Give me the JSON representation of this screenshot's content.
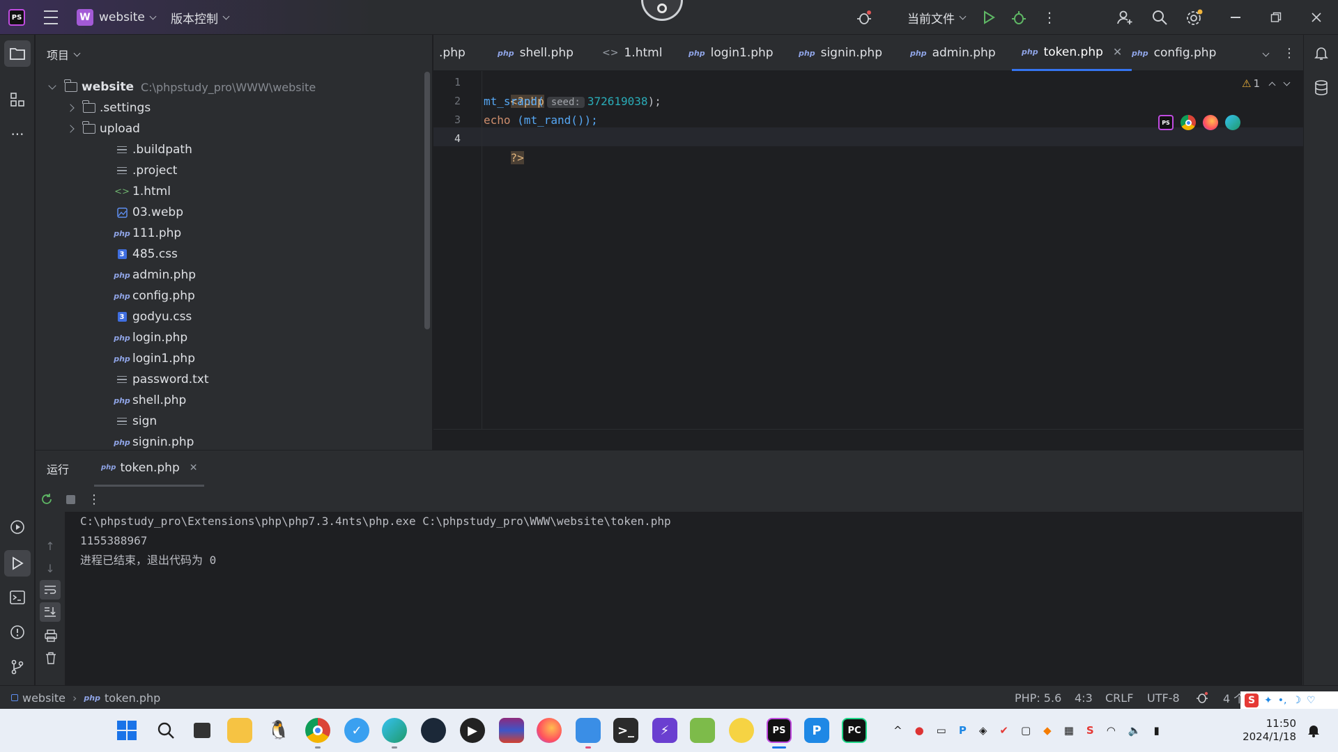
{
  "titlebar": {
    "project_name": "website",
    "project_badge": "W",
    "vcs_menu": "版本控制",
    "run_config": "当前文件"
  },
  "project_panel": {
    "header": "项目",
    "root": {
      "name": "website",
      "path": "C:\\phpstudy_pro\\WWW\\website"
    },
    "items": [
      {
        "name": ".settings",
        "type": "folder"
      },
      {
        "name": "upload",
        "type": "folder"
      },
      {
        "name": ".buildpath",
        "type": "text"
      },
      {
        "name": ".project",
        "type": "text"
      },
      {
        "name": "1.html",
        "type": "html"
      },
      {
        "name": "03.webp",
        "type": "image"
      },
      {
        "name": "111.php",
        "type": "php"
      },
      {
        "name": "485.css",
        "type": "css"
      },
      {
        "name": "admin.php",
        "type": "php"
      },
      {
        "name": "config.php",
        "type": "php"
      },
      {
        "name": "godyu.css",
        "type": "css"
      },
      {
        "name": "login.php",
        "type": "php"
      },
      {
        "name": "login1.php",
        "type": "php"
      },
      {
        "name": "password.txt",
        "type": "text"
      },
      {
        "name": "shell.php",
        "type": "php"
      },
      {
        "name": "sign",
        "type": "text"
      },
      {
        "name": "signin.php",
        "type": "php"
      }
    ]
  },
  "editor": {
    "tabs": [
      {
        "label": ".php",
        "type": "partial"
      },
      {
        "label": "shell.php",
        "type": "php"
      },
      {
        "label": "1.html",
        "type": "html"
      },
      {
        "label": "login1.php",
        "type": "php"
      },
      {
        "label": "signin.php",
        "type": "php"
      },
      {
        "label": "admin.php",
        "type": "php"
      },
      {
        "label": "token.php",
        "type": "php",
        "active": true
      },
      {
        "label": "config.php",
        "type": "php"
      }
    ],
    "line_numbers": [
      "1",
      "2",
      "3",
      "4"
    ],
    "code": {
      "line1_open_tag": "<?php",
      "line2_fn": "mt_srand(",
      "line2_hint": "seed:",
      "line2_num": "372619038",
      "line2_end": ");",
      "line3_kw": "echo",
      "line3_rest": "(mt_rand());",
      "line4_close_tag": "?>"
    },
    "warnings_count": "1"
  },
  "run_panel": {
    "run_tab": "运行",
    "file_tab": "token.php",
    "output": [
      "C:\\phpstudy_pro\\Extensions\\php\\php7.3.4nts\\php.exe C:\\phpstudy_pro\\WWW\\website\\token.php",
      "1155388967",
      "进程已结束，退出代码为 0"
    ]
  },
  "statusbar": {
    "breadcrumb_project": "website",
    "breadcrumb_file": "token.php",
    "php_version": "PHP: 5.6",
    "position": "4:3",
    "line_sep": "CRLF",
    "encoding": "UTF-8",
    "indent": "4 个"
  },
  "taskbar": {
    "time": "11:50",
    "date": "2024/1/18"
  },
  "colors": {
    "accent": "#3574f0",
    "keyword": "#cf8e6d",
    "function": "#56a8f5",
    "number": "#2aacb8"
  }
}
